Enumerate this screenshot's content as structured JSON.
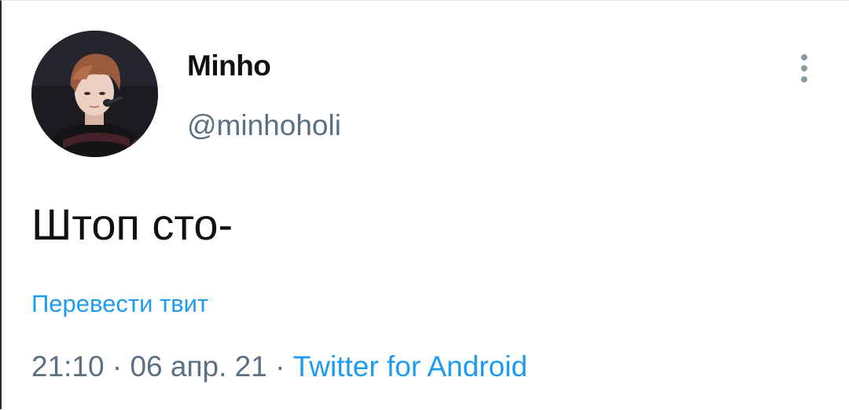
{
  "author": {
    "display_name": "Minho",
    "handle": "@minhoholi",
    "avatar": "profile-photo"
  },
  "menu": {
    "icon": "more-vertical-icon"
  },
  "tweet": {
    "text": "Штоп сто-",
    "translate_label": "Перевести твит",
    "time": "21:10",
    "separator1": " · ",
    "date": "06 апр. 21",
    "separator2": " · ",
    "source": "Twitter for Android"
  },
  "colors": {
    "link": "#1d9bf0",
    "secondary_text": "#5b7083",
    "primary_text": "#111111"
  }
}
